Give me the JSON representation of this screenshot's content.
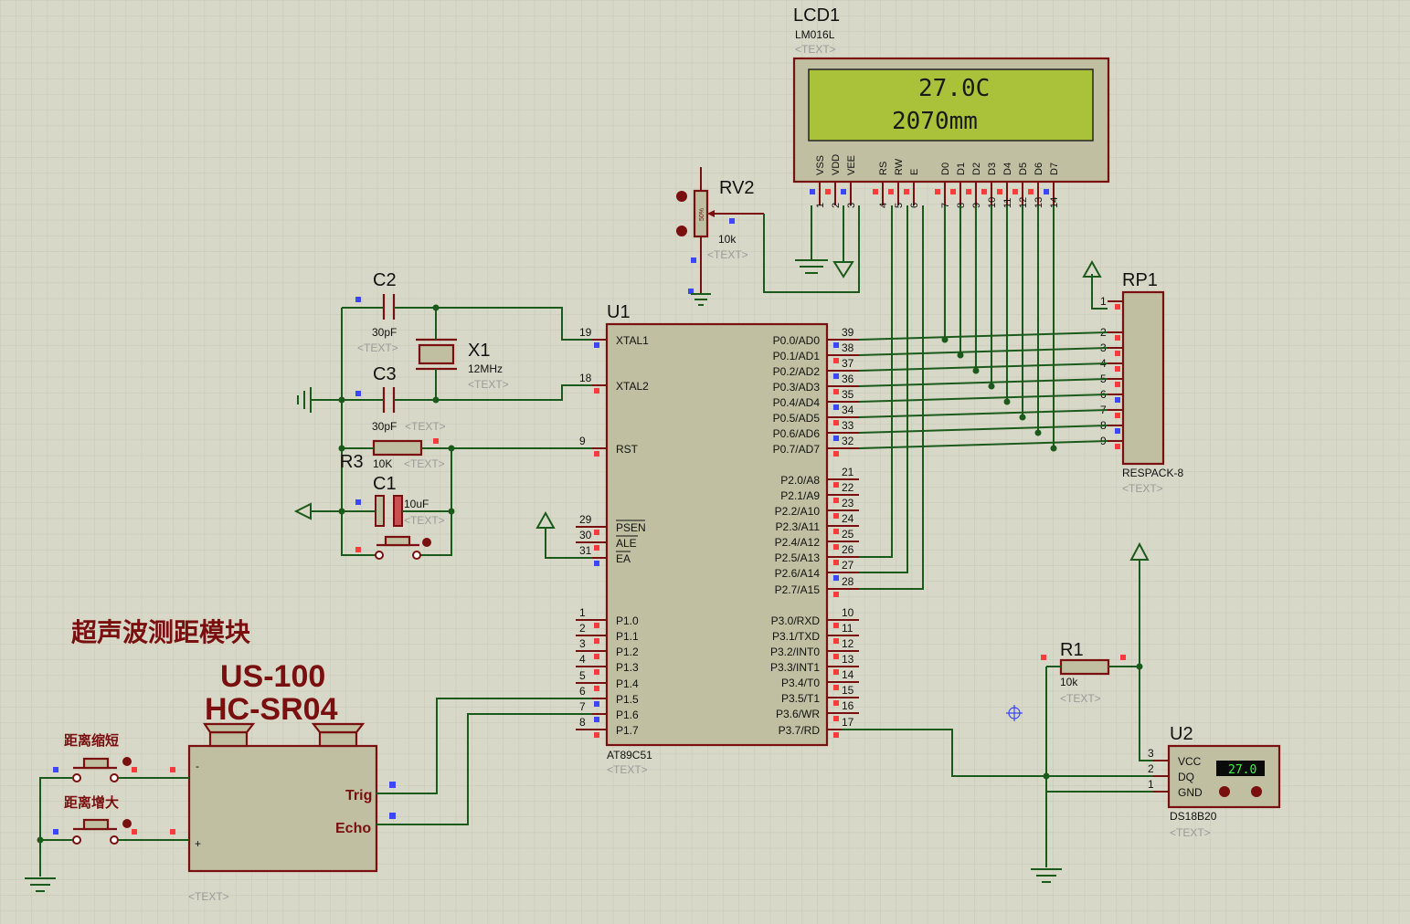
{
  "module_title": "超声波测距模块",
  "us_model_1": "US-100",
  "us_model_2": "HC-SR04",
  "btn_short": "距离缩短",
  "btn_long": "距离增大",
  "text_placeholder": "<TEXT>",
  "lcd": {
    "ref": "LCD1",
    "model": "LM016L",
    "line1": "27.0C",
    "line2": "2070mm",
    "pins": [
      "VSS",
      "VDD",
      "VEE",
      "RS",
      "RW",
      "E",
      "D0",
      "D1",
      "D2",
      "D3",
      "D4",
      "D5",
      "D6",
      "D7"
    ],
    "pin_nums": [
      "1",
      "2",
      "3",
      "4",
      "5",
      "6",
      "7",
      "8",
      "9",
      "10",
      "11",
      "12",
      "13",
      "14"
    ],
    "bg_color": "#a9c23a"
  },
  "rv2": {
    "ref": "RV2",
    "value": "10k",
    "pct": "50%"
  },
  "u1": {
    "ref": "U1",
    "model": "AT89C51",
    "left_pins": [
      {
        "num": "19",
        "name": "XTAL1"
      },
      {
        "num": "18",
        "name": "XTAL2"
      },
      {
        "num": "9",
        "name": "RST"
      },
      {
        "num": "29",
        "name": "PSEN"
      },
      {
        "num": "30",
        "name": "ALE"
      },
      {
        "num": "31",
        "name": "EA"
      },
      {
        "num": "1",
        "name": "P1.0"
      },
      {
        "num": "2",
        "name": "P1.1"
      },
      {
        "num": "3",
        "name": "P1.2"
      },
      {
        "num": "4",
        "name": "P1.3"
      },
      {
        "num": "5",
        "name": "P1.4"
      },
      {
        "num": "6",
        "name": "P1.5"
      },
      {
        "num": "7",
        "name": "P1.6"
      },
      {
        "num": "8",
        "name": "P1.7"
      }
    ],
    "right_pins": [
      {
        "num": "39",
        "name": "P0.0/AD0"
      },
      {
        "num": "38",
        "name": "P0.1/AD1"
      },
      {
        "num": "37",
        "name": "P0.2/AD2"
      },
      {
        "num": "36",
        "name": "P0.3/AD3"
      },
      {
        "num": "35",
        "name": "P0.4/AD4"
      },
      {
        "num": "34",
        "name": "P0.5/AD5"
      },
      {
        "num": "33",
        "name": "P0.6/AD6"
      },
      {
        "num": "32",
        "name": "P0.7/AD7"
      },
      {
        "num": "21",
        "name": "P2.0/A8"
      },
      {
        "num": "22",
        "name": "P2.1/A9"
      },
      {
        "num": "23",
        "name": "P2.2/A10"
      },
      {
        "num": "24",
        "name": "P2.3/A11"
      },
      {
        "num": "25",
        "name": "P2.4/A12"
      },
      {
        "num": "26",
        "name": "P2.5/A13"
      },
      {
        "num": "27",
        "name": "P2.6/A14"
      },
      {
        "num": "28",
        "name": "P2.7/A15"
      },
      {
        "num": "10",
        "name": "P3.0/RXD"
      },
      {
        "num": "11",
        "name": "P3.1/TXD"
      },
      {
        "num": "12",
        "name": "P3.2/INT0"
      },
      {
        "num": "13",
        "name": "P3.3/INT1"
      },
      {
        "num": "14",
        "name": "P3.4/T0"
      },
      {
        "num": "15",
        "name": "P3.5/T1"
      },
      {
        "num": "16",
        "name": "P3.6/WR"
      },
      {
        "num": "17",
        "name": "P3.7/RD"
      }
    ]
  },
  "rp1": {
    "ref": "RP1",
    "model": "RESPACK-8",
    "pins": [
      "1",
      "2",
      "3",
      "4",
      "5",
      "6",
      "7",
      "8",
      "9"
    ]
  },
  "c2": {
    "ref": "C2",
    "value": "30pF"
  },
  "c3": {
    "ref": "C3",
    "value": "30pF"
  },
  "x1": {
    "ref": "X1",
    "value": "12MHz"
  },
  "r3": {
    "ref": "R3",
    "value": "10K"
  },
  "c1": {
    "ref": "C1",
    "value": "10uF"
  },
  "r1": {
    "ref": "R1",
    "value": "10k"
  },
  "u2": {
    "ref": "U2",
    "model": "DS18B20",
    "pins": [
      {
        "num": "3",
        "name": "VCC"
      },
      {
        "num": "2",
        "name": "DQ"
      },
      {
        "num": "1",
        "name": "GND"
      }
    ],
    "readout": "27.0"
  },
  "us": {
    "trig": "Trig",
    "echo": "Echo",
    "minus": "-",
    "plus": "+"
  }
}
